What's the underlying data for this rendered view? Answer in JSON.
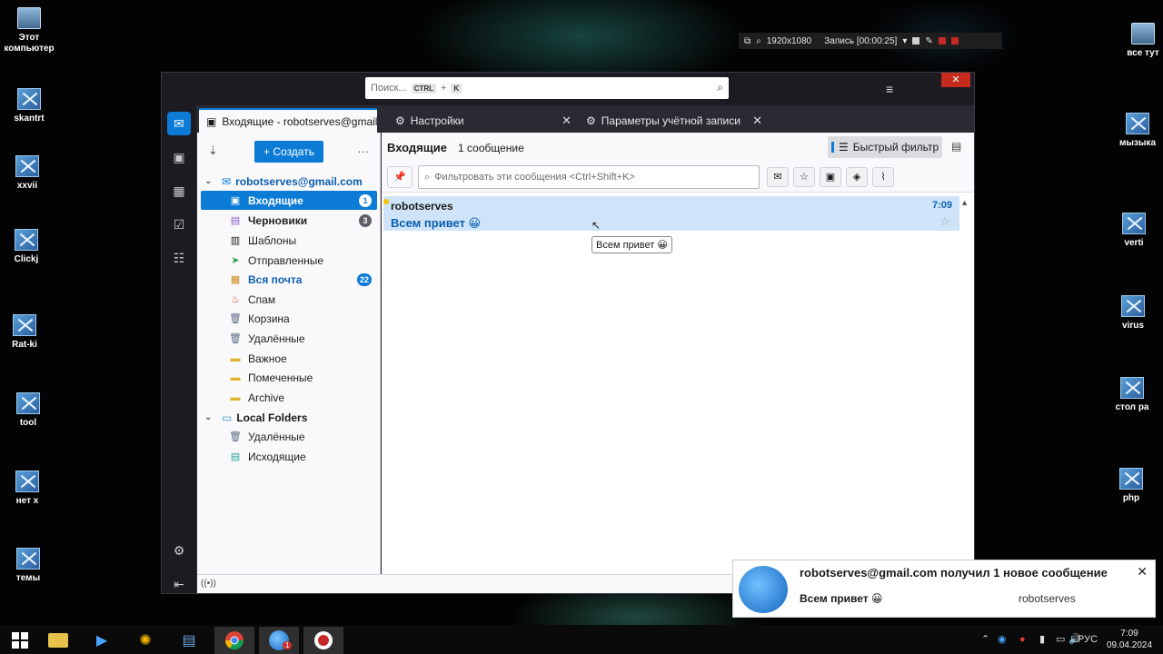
{
  "desktop": {
    "icons_left": [
      {
        "label": "Этот\nкомпьютер"
      },
      {
        "label": "skantrt"
      },
      {
        "label": "xxvii"
      },
      {
        "label": "Clickj"
      },
      {
        "label": "Rat-ki"
      },
      {
        "label": "tool"
      },
      {
        "label": "нет х"
      },
      {
        "label": "темы"
      }
    ],
    "icons_right": [
      {
        "label": "все тут"
      },
      {
        "label": "мызыка"
      },
      {
        "label": "verti"
      },
      {
        "label": "virus"
      },
      {
        "label": "стол ра"
      },
      {
        "label": "php"
      }
    ]
  },
  "recorder": {
    "resolution": "1920x1080",
    "status": "Запись [00:00:25]"
  },
  "window": {
    "close_glyph": "✕",
    "hamburger_glyph": "≡",
    "search": {
      "placeholder": "Поиск...",
      "key1": "CTRL",
      "plus": "+",
      "key2": "K"
    }
  },
  "tabs": [
    {
      "label": "Входящие - robotserves@gmail.com",
      "active": true
    },
    {
      "label": "Настройки",
      "close": "✕"
    },
    {
      "label": "Параметры учётной записи",
      "close": "✕"
    }
  ],
  "folder_pane": {
    "new_button": "+  Создать",
    "more": "…",
    "account": "robotserves@gmail.com",
    "folders": [
      {
        "label": "Входящие",
        "count": "1"
      },
      {
        "label": "Черновики",
        "count": "3"
      },
      {
        "label": "Шаблоны"
      },
      {
        "label": "Отправленные"
      },
      {
        "label": "Вся почта",
        "count": "22"
      },
      {
        "label": "Спам"
      },
      {
        "label": "Корзина"
      },
      {
        "label": "Удалённые"
      },
      {
        "label": "Важное"
      },
      {
        "label": "Помеченные"
      },
      {
        "label": "Archive"
      }
    ],
    "local_account": "Local Folders",
    "local_folders": [
      {
        "label": "Удалённые"
      },
      {
        "label": "Исходящие"
      }
    ]
  },
  "message_list": {
    "title": "Входящие",
    "count": "1 сообщение",
    "quick_filter": "Быстрый фильтр",
    "filter_placeholder": "Фильтровать эти сообщения <Ctrl+Shift+K>",
    "messages": [
      {
        "from": "robotserves",
        "subject": "Всем привет 😀",
        "time": "7:09"
      }
    ],
    "tooltip": "Всем привет 😀"
  },
  "notification": {
    "title": "robotserves@gmail.com получил 1 новое сообщение",
    "subject": "Всем привет 😀",
    "from": "robotserves",
    "close": "✕"
  },
  "taskbar": {
    "lang": "РУС",
    "time": "7:09",
    "date": "09.04.2024",
    "badge": "1"
  }
}
